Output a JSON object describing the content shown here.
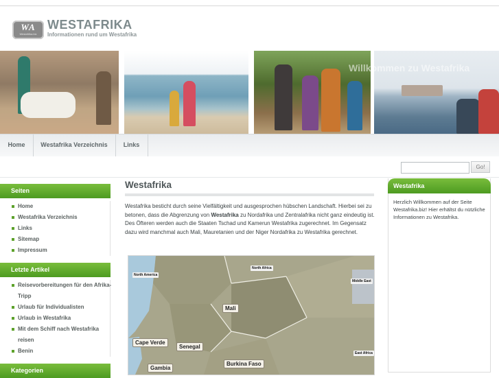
{
  "header": {
    "logo_abbr": "WA",
    "logo_sub": "Westafrika.biz",
    "title": "WESTAFRIKA",
    "subtitle": "Informationen rund um Westafrika"
  },
  "banner": {
    "welcome": "Willkommen zu Westafrika"
  },
  "nav": {
    "items": [
      "Home",
      "Westafrika Verzeichnis",
      "Links"
    ]
  },
  "search": {
    "value": "",
    "button": "Go!"
  },
  "sidebar": {
    "pages_title": "Seiten",
    "pages": [
      "Home",
      "Westafrika Verzeichnis",
      "Links",
      "Sitemap",
      "Impressum"
    ],
    "recent_title": "Letzte Artikel",
    "recent": [
      "Reisevorbereitungen für den Afrika-Tripp",
      "Urlaub für Individualisten",
      "Urlaub in Westafrika",
      "Mit dem Schiff nach Westafrika reisen",
      "Benin"
    ],
    "categories_title": "Kategorien"
  },
  "main": {
    "title": "Westafrika",
    "para_before": "Westafrika besticht durch seine Vielfältigkeit und ausgesprochen hübschen Landschaft. Hierbei sei zu betonen, dass die Abgrenzung von ",
    "para_bold": "Westafrika",
    "para_after": " zu Nordafrika und Zentralafrika nicht ganz eindeutig ist. Des Öfteren werden auch die Staaten Tschad und Kamerun Westafrika zugerechnet. Im Gegensatz dazu wird manchmal auch Mali, Mauretanien und der Niger Nordafrika zu Westafrika gerechnet."
  },
  "map": {
    "labels": [
      "Mali",
      "Cape Verde",
      "Senegal",
      "Gambia",
      "Burkina Faso"
    ],
    "small": [
      "North America",
      "North Africa",
      "Middle East",
      "East Africa"
    ]
  },
  "right": {
    "title": "Westafrika",
    "text": "Herzlich Willkommen auf der Seite Westafrika.biz! Hier erhältst du nützliche Informationen zu Westafrika."
  }
}
